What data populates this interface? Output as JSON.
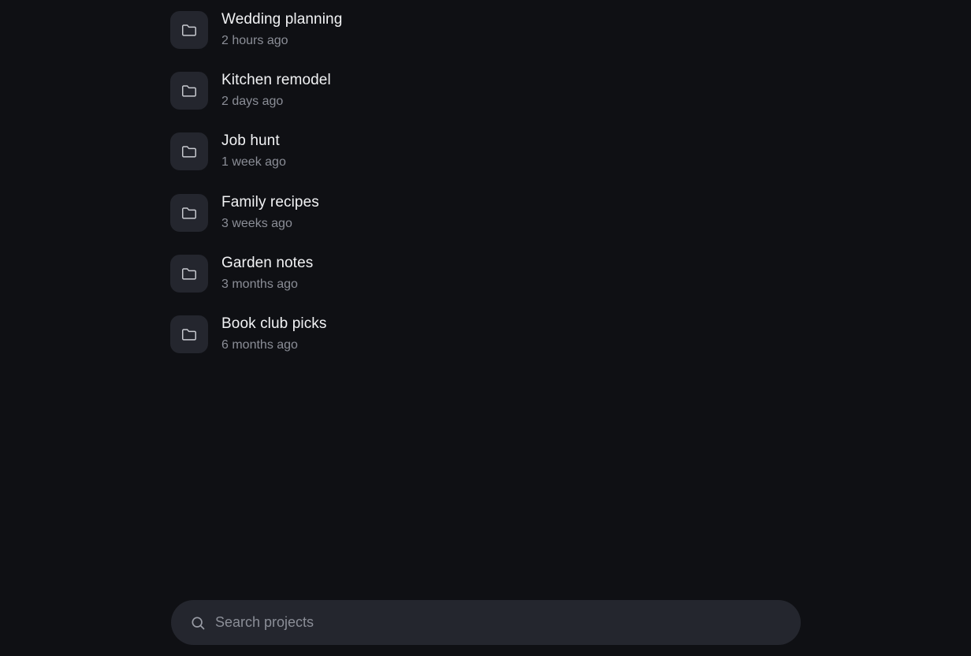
{
  "projects": [
    {
      "name": "Wedding planning",
      "time": "2 hours ago",
      "icon": "folder-icon"
    },
    {
      "name": "Kitchen remodel",
      "time": "2 days ago",
      "icon": "folder-icon"
    },
    {
      "name": "Job hunt",
      "time": "1 week ago",
      "icon": "folder-icon"
    },
    {
      "name": "Family recipes",
      "time": "3 weeks ago",
      "icon": "folder-icon"
    },
    {
      "name": "Garden notes",
      "time": "3 months ago",
      "icon": "folder-icon"
    },
    {
      "name": "Book club picks",
      "time": "6 months ago",
      "icon": "folder-icon"
    }
  ],
  "search": {
    "placeholder": "Search projects",
    "value": "",
    "icon": "search-icon"
  },
  "colors": {
    "background": "#0f1014",
    "tile": "#24262e",
    "title_text": "#f2f3f5",
    "muted_text": "#8b8e97"
  }
}
